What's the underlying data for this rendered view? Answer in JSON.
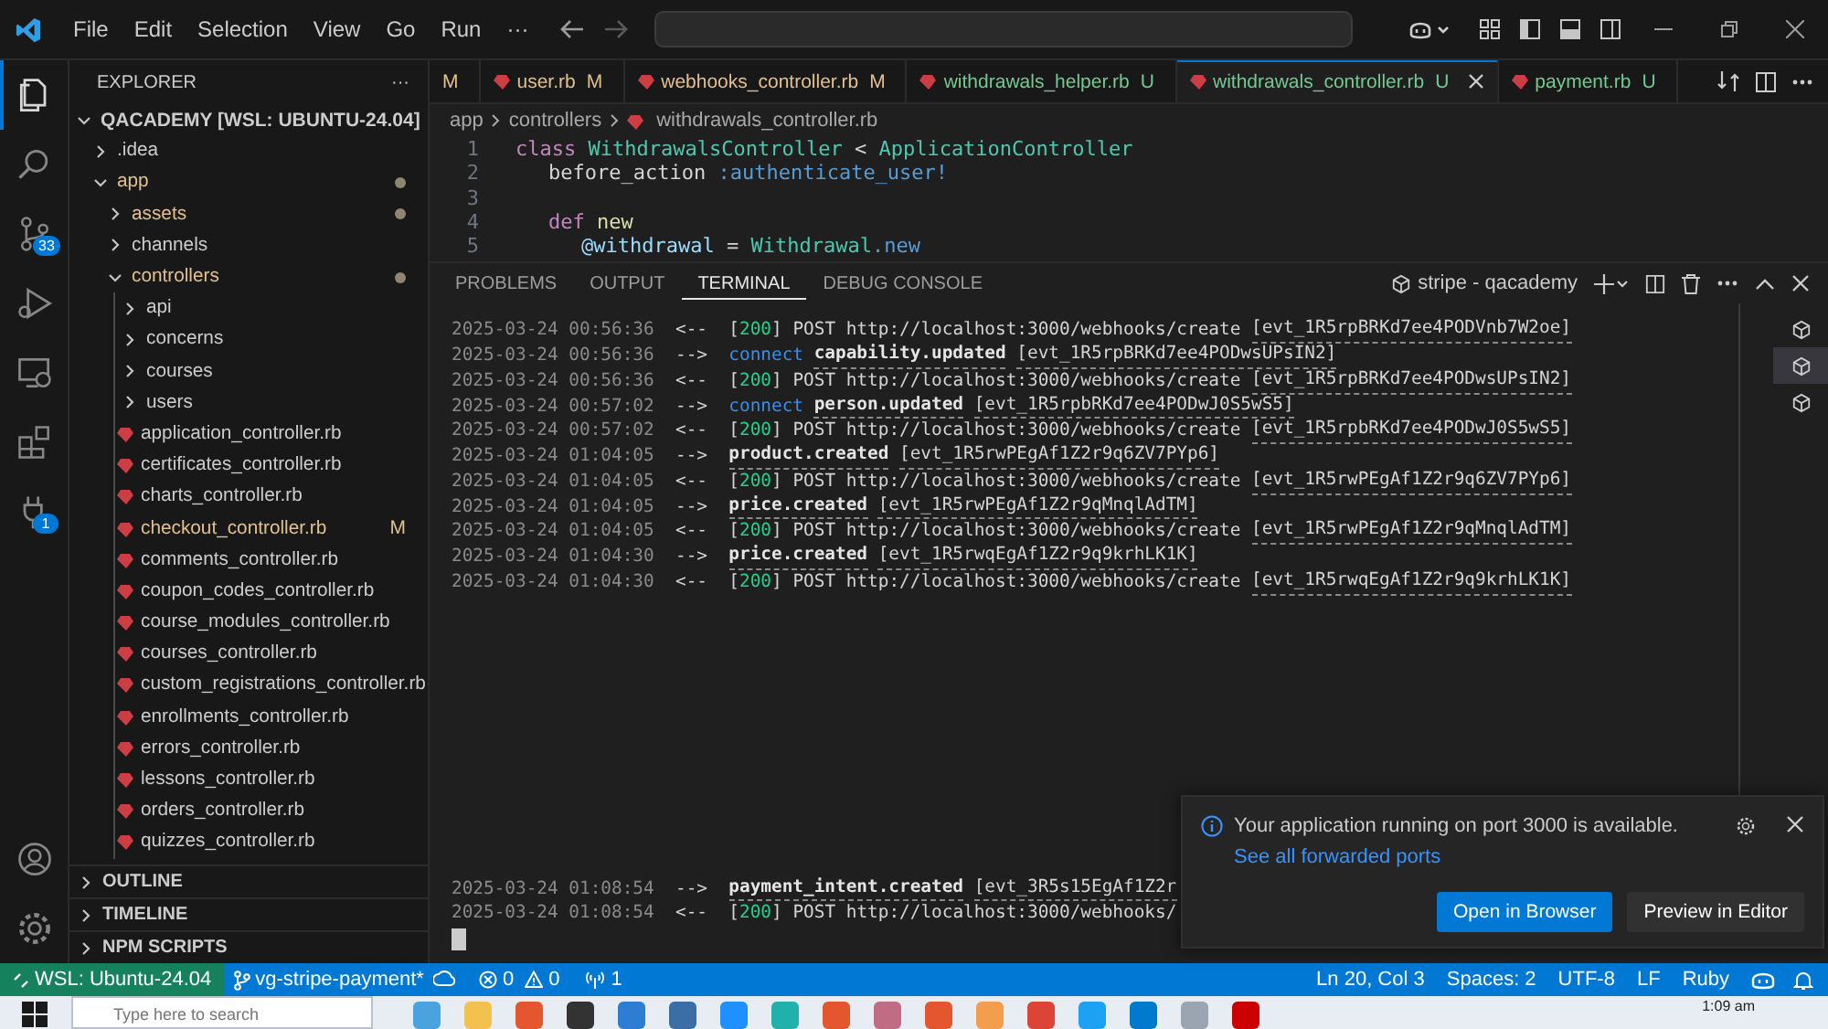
{
  "title_bar": {
    "menu": [
      "File",
      "Edit",
      "Selection",
      "View",
      "Go",
      "Run",
      "···"
    ]
  },
  "activity_bar": {
    "items": [
      {
        "kind": "explorer",
        "selected": true
      },
      {
        "kind": "search",
        "selected": false
      },
      {
        "kind": "source-control",
        "selected": false,
        "badge": "33"
      },
      {
        "kind": "run",
        "selected": false
      },
      {
        "kind": "remote",
        "selected": false
      },
      {
        "kind": "extensions",
        "selected": false
      },
      {
        "kind": "plug",
        "selected": false,
        "badge": "1"
      }
    ],
    "bottom": [
      {
        "kind": "account"
      },
      {
        "kind": "settings"
      }
    ]
  },
  "sidebar": {
    "title": "EXPLORER",
    "more": "···",
    "root": {
      "label": "QACADEMY [WSL: UBUNTU-24.04]",
      "expanded": true
    },
    "tree": [
      {
        "label": ".idea",
        "kind": "folder",
        "expanded": false,
        "modified": false
      },
      {
        "label": "app",
        "kind": "folder",
        "expanded": true,
        "modified": true,
        "children": [
          {
            "label": "assets",
            "kind": "folder",
            "expanded": false,
            "modified": true
          },
          {
            "label": "channels",
            "kind": "folder",
            "expanded": false,
            "modified": false
          },
          {
            "label": "controllers",
            "kind": "folder",
            "expanded": true,
            "modified": true,
            "children": [
              {
                "label": "api",
                "kind": "folder",
                "expanded": false,
                "modified": false
              },
              {
                "label": "concerns",
                "kind": "folder",
                "expanded": false,
                "modified": false
              },
              {
                "label": "courses",
                "kind": "folder",
                "expanded": false,
                "modified": false
              },
              {
                "label": "users",
                "kind": "folder",
                "expanded": false,
                "modified": false
              },
              {
                "label": "application_controller.rb",
                "kind": "file",
                "modified": false
              },
              {
                "label": "certificates_controller.rb",
                "kind": "file",
                "modified": false
              },
              {
                "label": "charts_controller.rb",
                "kind": "file",
                "modified": false
              },
              {
                "label": "checkout_controller.rb",
                "kind": "file",
                "modified": true,
                "badge": "M"
              },
              {
                "label": "comments_controller.rb",
                "kind": "file",
                "modified": false
              },
              {
                "label": "coupon_codes_controller.rb",
                "kind": "file",
                "modified": false
              },
              {
                "label": "course_modules_controller.rb",
                "kind": "file",
                "modified": false
              },
              {
                "label": "courses_controller.rb",
                "kind": "file",
                "modified": false
              },
              {
                "label": "custom_registrations_controller.rb",
                "kind": "file",
                "modified": false
              },
              {
                "label": "enrollments_controller.rb",
                "kind": "file",
                "modified": false
              },
              {
                "label": "errors_controller.rb",
                "kind": "file",
                "modified": false
              },
              {
                "label": "lessons_controller.rb",
                "kind": "file",
                "modified": false
              },
              {
                "label": "orders_controller.rb",
                "kind": "file",
                "modified": false
              },
              {
                "label": "quizzes_controller.rb",
                "kind": "file",
                "modified": false
              }
            ]
          }
        ]
      }
    ],
    "sections": [
      {
        "label": "OUTLINE",
        "expanded": false
      },
      {
        "label": "TIMELINE",
        "expanded": false
      },
      {
        "label": "NPM SCRIPTS",
        "expanded": false
      }
    ]
  },
  "tabs": [
    {
      "status": "M",
      "selected": false
    },
    {
      "label": "user.rb",
      "status": "M",
      "selected": false
    },
    {
      "label": "webhooks_controller.rb",
      "status": "M",
      "selected": false
    },
    {
      "label": "withdrawals_helper.rb",
      "status": "U",
      "selected": false
    },
    {
      "label": "withdrawals_controller.rb",
      "status": "U",
      "selected": true
    },
    {
      "label": "payment.rb",
      "status": "U",
      "selected": false
    }
  ],
  "breadcrumb": [
    "app",
    "controllers",
    "withdrawals_controller.rb"
  ],
  "code": [
    {
      "number": "1",
      "tokens": [
        {
          "kind": "keyword",
          "text": "class "
        },
        {
          "kind": "class",
          "text": "WithdrawalsController"
        },
        {
          "kind": "plain",
          "text": " < "
        },
        {
          "kind": "class",
          "text": "ApplicationController"
        }
      ],
      "children": [
        {
          "number": "2",
          "tokens": [
            {
              "kind": "plain",
              "text": "before_action "
            },
            {
              "kind": "symbol",
              "text": ":authenticate_user!"
            }
          ]
        },
        {
          "number": "3"
        },
        {
          "number": "4",
          "tokens": [
            {
              "kind": "keyword",
              "text": "def "
            },
            {
              "kind": "method",
              "text": "new"
            }
          ],
          "children": [
            {
              "number": "5",
              "tokens": [
                {
                  "kind": "ivar",
                  "text": "@withdrawal"
                },
                {
                  "kind": "plain",
                  "text": " = "
                },
                {
                  "kind": "class",
                  "text": "Withdrawal"
                },
                {
                  "kind": "symbol",
                  "text": ".new"
                }
              ]
            }
          ]
        }
      ]
    }
  ],
  "panel": {
    "tabs": [
      {
        "label": "PROBLEMS",
        "selected": false
      },
      {
        "label": "OUTPUT",
        "selected": false
      },
      {
        "label": "TERMINAL",
        "selected": true
      },
      {
        "label": "DEBUG CONSOLE",
        "selected": false
      }
    ],
    "terminal_name": "stripe - qacademy",
    "terminals": [
      {
        "selected": false
      },
      {
        "selected": true
      },
      {
        "selected": false
      }
    ],
    "lines": [
      {
        "time": "2025-03-24 00:56:36",
        "arrow": "<--",
        "kind": "post",
        "status": "[200]",
        "url": "POST http://localhost:3000/webhooks/create",
        "event_id": "[evt_1R5rpBRKd7ee4PODVnb7W2oe]"
      },
      {
        "time": "2025-03-24 00:56:36",
        "arrow": "-->",
        "kind": "event",
        "prefix": "connect",
        "event": "capability.updated",
        "event_id": "[evt_1R5rpBRKd7ee4PODwsUPsIN2]"
      },
      {
        "time": "2025-03-24 00:56:36",
        "arrow": "<--",
        "kind": "post",
        "status": "[200]",
        "url": "POST http://localhost:3000/webhooks/create",
        "event_id": "[evt_1R5rpBRKd7ee4PODwsUPsIN2]"
      },
      {
        "time": "2025-03-24 00:57:02",
        "arrow": "-->",
        "kind": "event",
        "prefix": "connect",
        "event": "person.updated",
        "event_id": "[evt_1R5rpbRKd7ee4PODwJ0S5wS5]"
      },
      {
        "time": "2025-03-24 00:57:02",
        "arrow": "<--",
        "kind": "post",
        "status": "[200]",
        "url": "POST http://localhost:3000/webhooks/create",
        "event_id": "[evt_1R5rpbRKd7ee4PODwJ0S5wS5]"
      },
      {
        "time": "2025-03-24 01:04:05",
        "arrow": "-->",
        "kind": "event",
        "event": "product.created",
        "event_id": "[evt_1R5rwPEgAf1Z2r9q6ZV7PYp6]"
      },
      {
        "time": "2025-03-24 01:04:05",
        "arrow": "<--",
        "kind": "post",
        "status": "[200]",
        "url": "POST http://localhost:3000/webhooks/create",
        "event_id": "[evt_1R5rwPEgAf1Z2r9q6ZV7PYp6]"
      },
      {
        "time": "2025-03-24 01:04:05",
        "arrow": "-->",
        "kind": "event",
        "event": "price.created",
        "event_id": "[evt_1R5rwPEgAf1Z2r9qMnqlAdTM]"
      },
      {
        "time": "2025-03-24 01:04:05",
        "arrow": "<--",
        "kind": "post",
        "status": "[200]",
        "url": "POST http://localhost:3000/webhooks/create",
        "event_id": "[evt_1R5rwPEgAf1Z2r9qMnqlAdTM]"
      },
      {
        "time": "2025-03-24 01:04:30",
        "arrow": "-->",
        "kind": "event",
        "event": "price.created",
        "event_id": "[evt_1R5rwqEgAf1Z2r9q9krhLK1K]"
      },
      {
        "time": "2025-03-24 01:04:30",
        "arrow": "<--",
        "kind": "post",
        "status": "[200]",
        "url": "POST http://localhost:3000/webhooks/create",
        "event_id": "[evt_1R5rwqEgAf1Z2r9q9krhLK1K]"
      }
    ],
    "lines_after_gap": [
      {
        "time": "2025-03-24 01:08:54",
        "arrow": "-->",
        "kind": "event",
        "event": "payment_intent.created",
        "event_id": "[evt_3R5s15EgAf1Z2r"
      },
      {
        "time": "2025-03-24 01:08:54",
        "arrow": "<--",
        "kind": "post",
        "status": "[200]",
        "url": "POST http://localhost:3000/webhooks/"
      }
    ]
  },
  "notification": {
    "message": "Your application running on port 3000 is available.",
    "link": "See all forwarded ports",
    "buttons": [
      {
        "label": "Open in Browser",
        "primary": true
      },
      {
        "label": "Preview in Editor",
        "primary": false
      }
    ]
  },
  "status_bar": {
    "remote": "WSL: Ubuntu-24.04",
    "branch": "vg-stripe-payment*",
    "errors": "0",
    "warnings": "0",
    "ports": "1",
    "right": [
      "Ln 20, Col 3",
      "Spaces: 2",
      "UTF-8",
      "LF",
      "Ruby"
    ]
  },
  "taskbar": {
    "search_placeholder": "Type here to search",
    "apps": [
      {
        "color": "#4aa3df"
      },
      {
        "color": "#f2c14e"
      },
      {
        "color": "#e4572e"
      },
      {
        "color": "#333333"
      },
      {
        "color": "#2d7dd2"
      },
      {
        "color": "#3a6ea5"
      },
      {
        "color": "#1e90ff"
      },
      {
        "color": "#20b2aa"
      },
      {
        "color": "#e4572e"
      },
      {
        "color": "#c06c84"
      },
      {
        "color": "#e4572e"
      },
      {
        "color": "#f29e4c"
      },
      {
        "color": "#db4437"
      },
      {
        "color": "#1da1f2"
      },
      {
        "color": "#007acc"
      },
      {
        "color": "#9aa5b1"
      },
      {
        "color": "#cc0000"
      }
    ],
    "time": "1:09 am"
  }
}
